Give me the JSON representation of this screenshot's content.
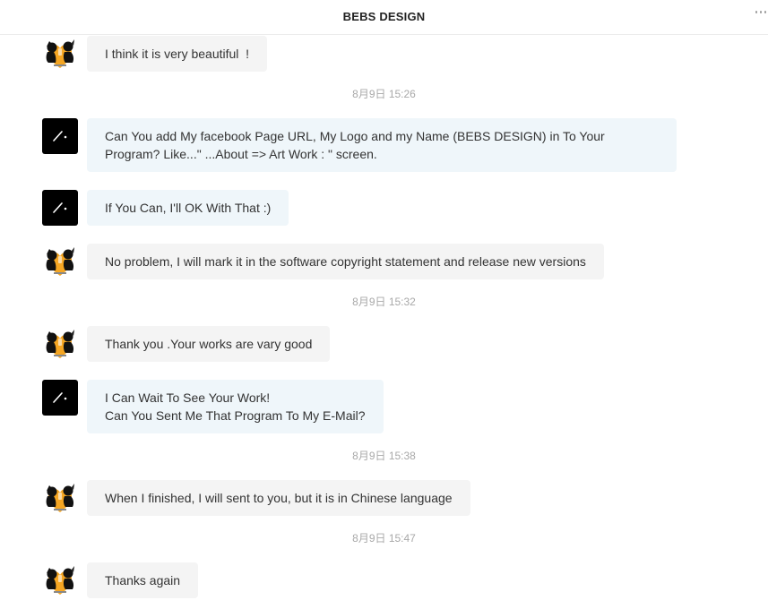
{
  "header": {
    "title": "BEBS DESIGN",
    "more_icon": "more-dots-icon"
  },
  "messages": [
    {
      "sender": "me",
      "avatar": "cartoon-couple-avatar",
      "text": [
        "I think it is very beautiful  !"
      ]
    },
    {
      "time": "8月9日 15:26"
    },
    {
      "sender": "other",
      "avatar": "bebs-logo-avatar",
      "text": [
        "Can You add My facebook Page URL, My Logo and my Name (BEBS DESIGN) in To Your",
        "Program? Like...\" ...About => Art Work : \" screen."
      ]
    },
    {
      "sender": "other",
      "avatar": "bebs-logo-avatar",
      "text": [
        "If You Can, I'll OK With That :)"
      ]
    },
    {
      "sender": "me",
      "avatar": "cartoon-couple-avatar",
      "text": [
        "No problem, I will mark it in the software copyright statement and release new versions"
      ]
    },
    {
      "time": "8月9日 15:32"
    },
    {
      "sender": "me",
      "avatar": "cartoon-couple-avatar",
      "text": [
        "Thank you .Your works are vary good"
      ]
    },
    {
      "sender": "other",
      "avatar": "bebs-logo-avatar",
      "text": [
        "I Can Wait To See Your Work!",
        "Can You Sent Me That Program To My E-Mail?"
      ]
    },
    {
      "time": "8月9日 15:38"
    },
    {
      "sender": "me",
      "avatar": "cartoon-couple-avatar",
      "text": [
        "When I finished, I will sent to you, but it is in Chinese language"
      ]
    },
    {
      "time": "8月9日 15:47"
    },
    {
      "sender": "me",
      "avatar": "cartoon-couple-avatar",
      "text": [
        "Thanks again"
      ]
    }
  ],
  "colors": {
    "my_bubble": "#f4f4f4",
    "their_bubble": "#eff6fa",
    "timestamp": "#a9a9a9",
    "avatar_heart": "#f5a623"
  }
}
